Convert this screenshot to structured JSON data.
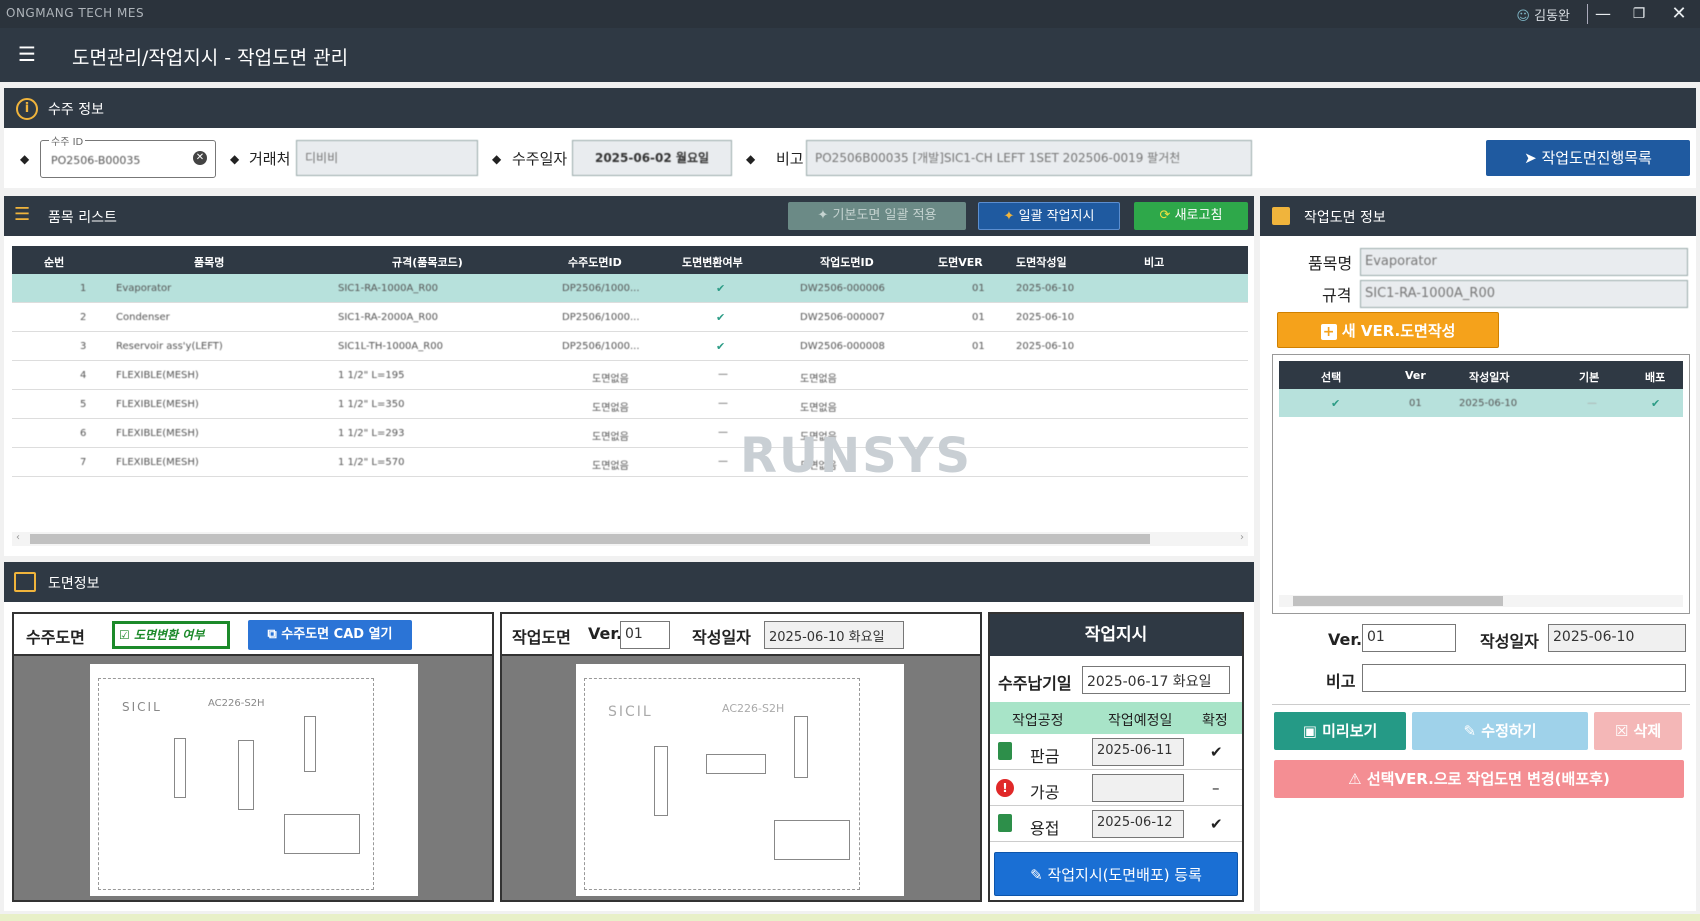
{
  "window": {
    "app_title": "ONGMANG TECH MES",
    "user_name": "김동완"
  },
  "header": {
    "page_title": "도면관리/작업지시 - 작업도면 관리"
  },
  "order_info": {
    "title": "수주 정보",
    "order_id_label": "수주 ID",
    "order_id_value": "PO2506-B00035",
    "client_label": "거래처",
    "client_value": "디비비",
    "order_date_label": "수주일자",
    "order_date_value": "2025-06-02 월요일",
    "note_label": "비고",
    "note_value": "PO2506B00035 [개발]SIC1-CH LEFT 1SET 202506-0019 팔거천",
    "progress_button": "작업도면진행목록"
  },
  "items": {
    "title": "품목 리스트",
    "btn_apply_default": "기본도면 일괄 적용",
    "btn_bulk_order": "일괄 작업지시",
    "btn_refresh": "새로고침",
    "columns": [
      "순번",
      "품목명",
      "규격(품목코드)",
      "수주도면ID",
      "도면변환여부",
      "작업도면ID",
      "도면VER",
      "도면작성일",
      "비고"
    ],
    "rows": [
      {
        "no": "1",
        "name": "Evaporator",
        "spec": "SIC1-RA-1000A_R00",
        "order_dwg": "DP2506/1000...",
        "converted": "✔",
        "work_dwg": "DW2506-000006",
        "ver": "01",
        "date": "2025-06-10"
      },
      {
        "no": "2",
        "name": "Condenser",
        "spec": "SIC1-RA-2000A_R00",
        "order_dwg": "DP2506/1000...",
        "converted": "✔",
        "work_dwg": "DW2506-000007",
        "ver": "01",
        "date": "2025-06-10"
      },
      {
        "no": "3",
        "name": "Reservoir ass'y(LEFT)",
        "spec": "SIC1L-TH-1000A_R00",
        "order_dwg": "DP2506/1000...",
        "converted": "✔",
        "work_dwg": "DW2506-000008",
        "ver": "01",
        "date": "2025-06-10"
      },
      {
        "no": "4",
        "name": "FLEXIBLE(MESH)",
        "spec": "1 1/2\" L=195",
        "order_dwg": "도면없음",
        "converted": "—",
        "work_dwg": "도면없음",
        "ver": "",
        "date": ""
      },
      {
        "no": "5",
        "name": "FLEXIBLE(MESH)",
        "spec": "1 1/2\" L=350",
        "order_dwg": "도면없음",
        "converted": "—",
        "work_dwg": "도면없음",
        "ver": "",
        "date": ""
      },
      {
        "no": "6",
        "name": "FLEXIBLE(MESH)",
        "spec": "1 1/2\" L=293",
        "order_dwg": "도면없음",
        "converted": "—",
        "work_dwg": "도면없음",
        "ver": "",
        "date": ""
      },
      {
        "no": "7",
        "name": "FLEXIBLE(MESH)",
        "spec": "1 1/2\" L=570",
        "order_dwg": "도면없음",
        "converted": "—",
        "work_dwg": "도면없음",
        "ver": "",
        "date": ""
      }
    ],
    "watermark": "RUNSYS"
  },
  "work_drawing_info": {
    "title": "작업도면 정보",
    "item_name_label": "품목명",
    "item_name_value": "Evaporator",
    "spec_label": "규격",
    "spec_value": "SIC1-RA-1000A_R00",
    "new_ver_button": "새 VER.도면작성",
    "ver_columns": [
      "선택",
      "Ver",
      "작성일자",
      "기본",
      "배포"
    ],
    "ver_rows": [
      {
        "select": "✔",
        "ver": "01",
        "date": "2025-06-10",
        "default": "—",
        "deploy": "✔"
      }
    ],
    "ver_label": "Ver.",
    "ver_value": "01",
    "written_date_label": "작성일자",
    "written_date_value": "2025-06-10",
    "note_label": "비고",
    "note_value": "",
    "preview_button": "미리보기",
    "edit_button": "수정하기",
    "delete_button": "삭제",
    "change_button": "선택VER.으로 작업도면 변경(배포후)"
  },
  "drawing_info": {
    "title": "도면정보",
    "order_drawing_label": "수주도면",
    "converted_label": "도면변환 여부",
    "open_cad_button": "수주도면 CAD 열기",
    "work_drawing_label": "작업도면",
    "ver_label": "Ver.",
    "ver_value": "01",
    "written_date_label": "작성일자",
    "written_date_value": "2025-06-10 화요일",
    "drawing_text_1": "SICIL",
    "drawing_text_2": "AC226-S2H"
  },
  "work_order": {
    "title": "작업지시",
    "due_date_label": "수주납기일",
    "due_date_value": "2025-06-17 화요일",
    "columns": [
      "작업공정",
      "작업예정일",
      "확정"
    ],
    "rows": [
      {
        "process": "판금",
        "date": "2025-06-11",
        "confirmed": "✔"
      },
      {
        "process": "가공",
        "date": "",
        "confirmed": "–"
      },
      {
        "process": "용접",
        "date": "2025-06-12",
        "confirmed": "✔"
      }
    ],
    "register_button": "작업지시(도면배포) 등록"
  }
}
